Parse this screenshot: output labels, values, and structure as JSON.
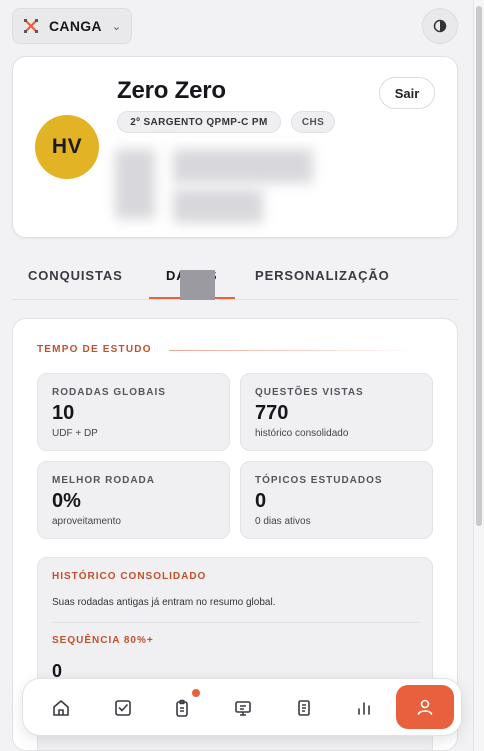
{
  "brand": {
    "name": "CANGA",
    "logo_icon": "crossed-logo-icon",
    "accent": "#e8613c"
  },
  "profile": {
    "initials": "HV",
    "name": "Zero Zero",
    "rank": "2º SARGENTO QPMP-C PM",
    "unit": "CHS",
    "logout_label": "Sair",
    "avatar_color": "#e2b325"
  },
  "tabs": [
    {
      "label": "CONQUISTAS",
      "active": false
    },
    {
      "label": "DADOS",
      "active": true
    },
    {
      "label": "PERSONALIZAÇÃO",
      "active": false
    }
  ],
  "study": {
    "section_title": "TEMPO DE ESTUDO",
    "stats": [
      {
        "label": "RODADAS GLOBAIS",
        "value": "10",
        "sub": "UDF + DP"
      },
      {
        "label": "QUESTÕES VISTAS",
        "value": "770",
        "sub": "histórico consolidado"
      },
      {
        "label": "MELHOR RODADA",
        "value": "0%",
        "sub": "aproveitamento"
      },
      {
        "label": "TÓPICOS ESTUDADOS",
        "value": "0",
        "sub": "0 dias ativos"
      }
    ],
    "history": {
      "title": "HISTÓRICO CONSOLIDADO",
      "text": "Suas rodadas antigas já entram no resumo global.",
      "streak_title": "SEQUÊNCIA 80%+",
      "streak_value": "0"
    }
  },
  "nav": {
    "items": [
      {
        "icon": "home-icon"
      },
      {
        "icon": "checkbox-icon"
      },
      {
        "icon": "clipboard-icon",
        "badge": true
      },
      {
        "icon": "monitor-icon"
      },
      {
        "icon": "document-icon"
      },
      {
        "icon": "bar-chart-icon"
      },
      {
        "icon": "user-icon",
        "active": true
      }
    ]
  }
}
